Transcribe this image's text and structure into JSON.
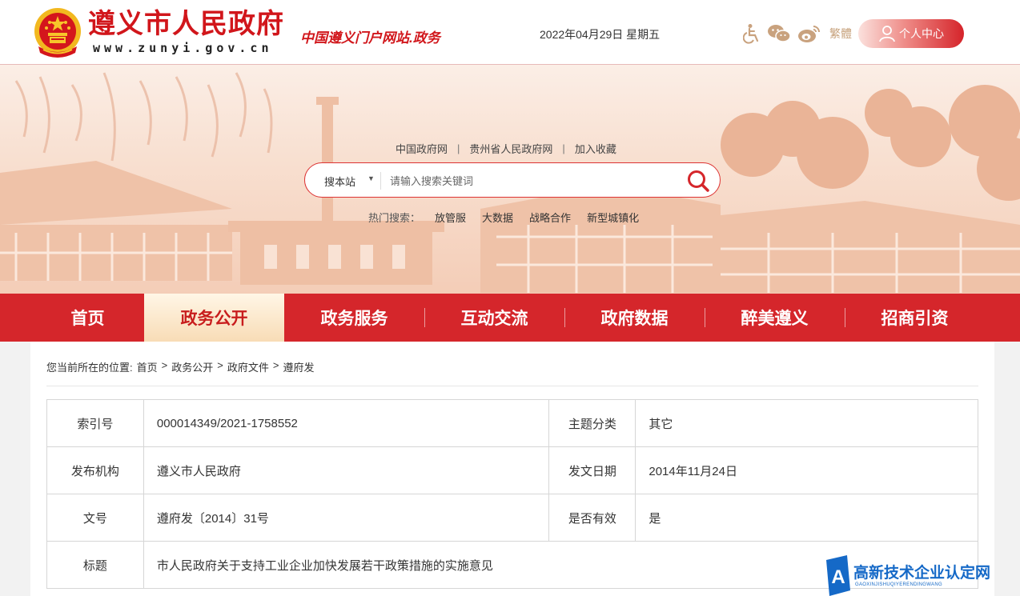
{
  "header": {
    "site_title": "遵义市人民政府",
    "site_domain": "www.zunyi.gov.cn",
    "slogan": "中国遵义门户网站.政务",
    "date": "2022年04月29日  星期五",
    "traditional_label": "繁體",
    "user_center_label": "个人中心",
    "icons": [
      "accessibility-icon",
      "wechat-icon",
      "weibo-icon",
      "user-icon"
    ]
  },
  "banner": {
    "quick_links": [
      "中国政府网",
      "贵州省人民政府网",
      "加入收藏"
    ],
    "link_separator": "|",
    "search": {
      "scope": "搜本站",
      "placeholder": "请输入搜索关键词"
    },
    "hot_search_label": "热门搜索：",
    "hot_search_items": [
      "放管服",
      "大数据",
      "战略合作",
      "新型城镇化"
    ]
  },
  "nav": {
    "items": [
      "首页",
      "政务公开",
      "政务服务",
      "互动交流",
      "政府数据",
      "醉美遵义",
      "招商引资"
    ],
    "active_index": 1
  },
  "breadcrumb": {
    "prefix": "您当前所在的位置:",
    "items": [
      "首页",
      "政务公开",
      "政府文件",
      "遵府发"
    ],
    "separator": ">"
  },
  "meta_table": {
    "rows": [
      {
        "label1": "索引号",
        "value1": "000014349/2021-1758552",
        "label2": "主题分类",
        "value2": "其它"
      },
      {
        "label1": "发布机构",
        "value1": "遵义市人民政府",
        "label2": "发文日期",
        "value2": "2014年11月24日"
      },
      {
        "label1": "文号",
        "value1": "遵府发〔2014〕31号",
        "label2": "是否有效",
        "value2": "是"
      },
      {
        "label1": "标题",
        "value1": "市人民政府关于支持工业企业加快发展若干政策措施的实施意见"
      }
    ]
  },
  "watermark": {
    "text": "高新技术企业认定网",
    "subtext": "GAOXINJISHUQIYERENDINGWANG"
  },
  "colors": {
    "brand_red": "#d5262b",
    "title_red": "#d1161b",
    "watermark_blue": "#1569c7"
  }
}
